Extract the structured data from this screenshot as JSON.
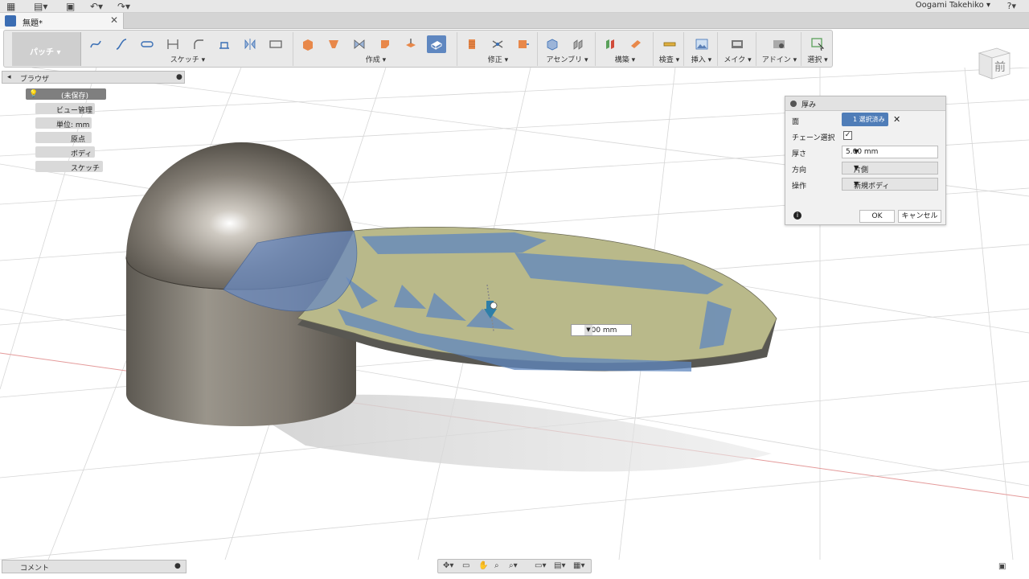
{
  "user": {
    "name": "Oogami Takehiko ▾"
  },
  "tab": {
    "title": "無題*"
  },
  "toolbar": {
    "workspace": "パッチ ▾",
    "groups": [
      {
        "label": "スケッチ ▾"
      },
      {
        "label": "作成 ▾"
      },
      {
        "label": "修正 ▾"
      },
      {
        "label": "アセンブリ ▾"
      },
      {
        "label": "構築 ▾"
      },
      {
        "label": "検査 ▾"
      },
      {
        "label": "挿入 ▾"
      },
      {
        "label": "メイク ▾"
      },
      {
        "label": "アドイン ▾"
      },
      {
        "label": "選択 ▾"
      }
    ]
  },
  "viewcube": {
    "face": "前"
  },
  "browser": {
    "title": "ブラウザ",
    "root": "(未保存)",
    "items": [
      {
        "label": "ビュー管理"
      },
      {
        "label": "単位: mm"
      },
      {
        "label": "原点"
      },
      {
        "label": "ボディ"
      },
      {
        "label": "スケッチ"
      }
    ]
  },
  "dialog": {
    "title": "厚み",
    "face_label": "面",
    "face_value": "1 選択済み",
    "chain_label": "チェーン選択",
    "thickness_label": "厚さ",
    "thickness_value": "5.00 mm",
    "direction_label": "方向",
    "direction_value": "片側",
    "operation_label": "操作",
    "operation_value": "新規ボディ",
    "ok": "OK",
    "cancel": "キャンセル"
  },
  "viewport": {
    "value_box": "5.00 mm"
  },
  "comments": {
    "title": "コメント"
  },
  "colors": {
    "selection": "#5f87c0",
    "patch": "#b9b98a",
    "body": "#8c877d"
  }
}
